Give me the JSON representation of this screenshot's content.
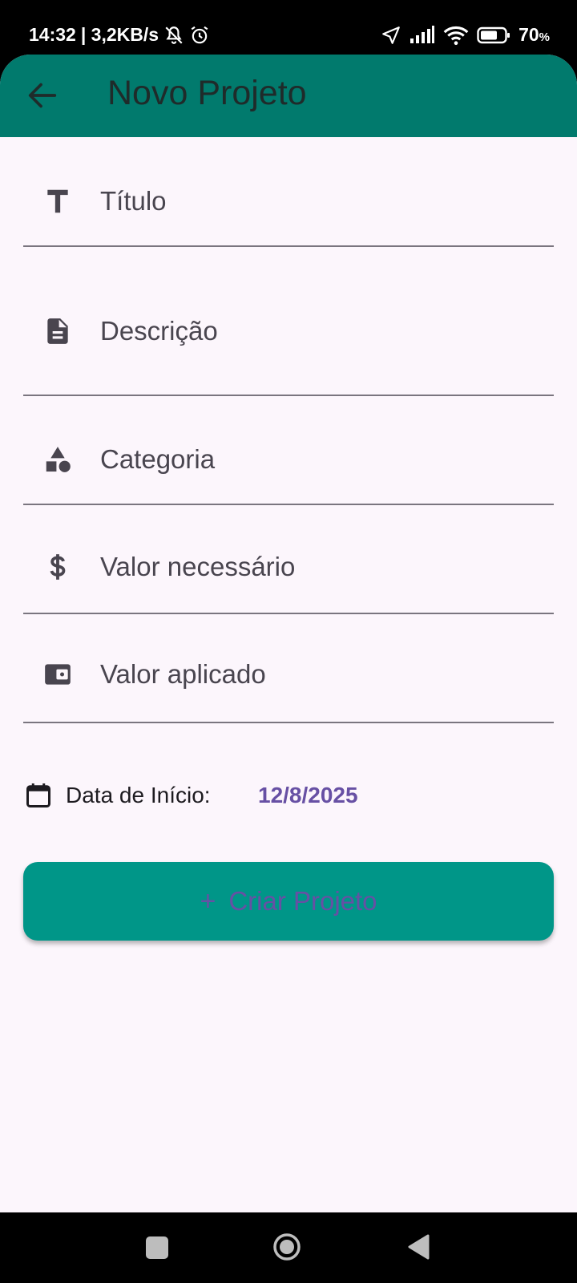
{
  "status_bar": {
    "time": "14:32",
    "net_speed": "| 3,2KB/s",
    "battery_value": "70",
    "battery_unit": "%"
  },
  "appbar": {
    "title": "Novo Projeto"
  },
  "form": {
    "fields": [
      {
        "label": "Título",
        "icon": "title-icon"
      },
      {
        "label": "Descrição",
        "icon": "description-icon"
      },
      {
        "label": "Categoria",
        "icon": "category-icon"
      },
      {
        "label": "Valor necessário",
        "icon": "dollar-icon"
      },
      {
        "label": "Valor aplicado",
        "icon": "wallet-icon"
      }
    ],
    "date_label": "Data de Início:",
    "date_value": "12/8/2025"
  },
  "button": {
    "plus": "+",
    "label": "Criar Projeto"
  },
  "colors": {
    "appbar": "#017A6D",
    "background": "#FCF6FC",
    "button": "#009688",
    "accent": "#6750A4"
  }
}
